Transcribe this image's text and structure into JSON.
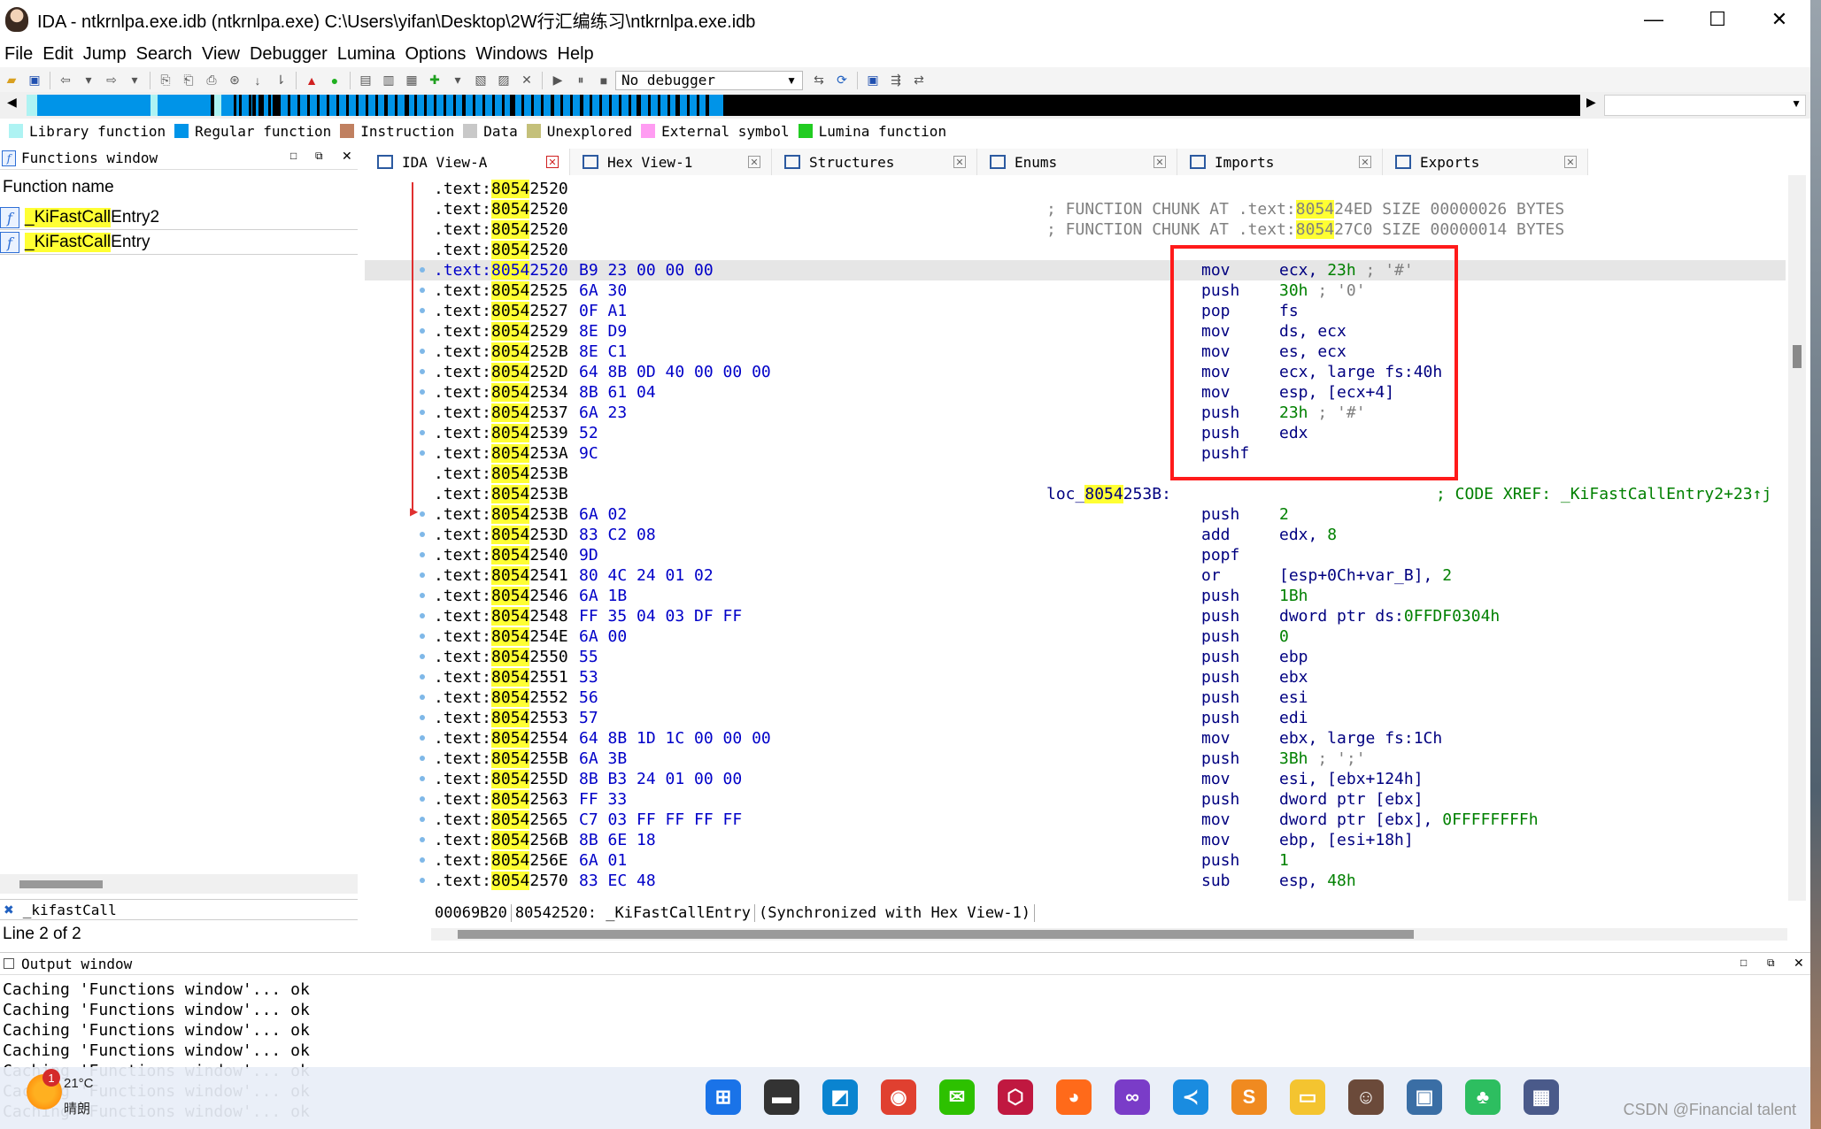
{
  "window": {
    "title": "IDA - ntkrnlpa.exe.idb (ntkrnlpa.exe) C:\\Users\\yifan\\Desktop\\2W行汇编练习\\ntkrnlpa.exe.idb",
    "minimize": "—",
    "maximize": "☐",
    "close": "✕"
  },
  "menu": [
    "File",
    "Edit",
    "Jump",
    "Search",
    "View",
    "Debugger",
    "Lumina",
    "Options",
    "Windows",
    "Help"
  ],
  "toolbar": {
    "debugger": "No debugger"
  },
  "legend": [
    {
      "label": "Library function",
      "color": "#aef3f3"
    },
    {
      "label": "Regular function",
      "color": "#0094e8"
    },
    {
      "label": "Instruction",
      "color": "#c08060"
    },
    {
      "label": "Data",
      "color": "#c8c8c8"
    },
    {
      "label": "Unexplored",
      "color": "#c4c07a"
    },
    {
      "label": "External symbol",
      "color": "#ff9cf2"
    },
    {
      "label": "Lumina function",
      "color": "#22cc22"
    }
  ],
  "functions_window": {
    "title": "Functions window",
    "column": "Function name",
    "items": [
      {
        "highlight": "_KiFastCall",
        "rest": "Entry2"
      },
      {
        "highlight": "_KiFastCall",
        "rest": "Entry"
      }
    ],
    "filter": "_kifastCall",
    "status": "Line 2 of 2"
  },
  "tabs": [
    {
      "label": "IDA View-A",
      "icon": "ida-view-icon"
    },
    {
      "label": "Hex View-1",
      "icon": "hex-view-icon"
    },
    {
      "label": "Structures",
      "icon": "structures-icon"
    },
    {
      "label": "Enums",
      "icon": "enums-icon"
    },
    {
      "label": "Imports",
      "icon": "imports-icon"
    },
    {
      "label": "Exports",
      "icon": "exports-icon"
    }
  ],
  "disasm": {
    "seg_prefix": ".text:",
    "addr_hl": "8054",
    "lines": [
      {
        "addr_rest": "2520"
      },
      {
        "addr_rest": "2520",
        "chunk": "; FUNCTION CHUNK AT .text:",
        "chunk_hl": "8054",
        "chunk_rest": "24ED SIZE 00000026 BYTES"
      },
      {
        "addr_rest": "2520",
        "chunk": "; FUNCTION CHUNK AT .text:",
        "chunk_hl": "8054",
        "chunk_rest": "27C0 SIZE 00000014 BYTES"
      },
      {
        "addr_rest": "2520"
      },
      {
        "addr_rest": "2520",
        "bytes": "B9 23 00 00 00",
        "mnem": "mov",
        "ops": "ecx, ",
        "num": "23h",
        "cmt": " ; '#'",
        "dot": true,
        "current": true
      },
      {
        "addr_rest": "2525",
        "bytes": "6A 30",
        "mnem": "push",
        "ops": "",
        "num": "30h",
        "cmt": " ; '0'",
        "dot": true
      },
      {
        "addr_rest": "2527",
        "bytes": "0F A1",
        "mnem": "pop",
        "ops": "fs",
        "dot": true
      },
      {
        "addr_rest": "2529",
        "bytes": "8E D9",
        "mnem": "mov",
        "ops": "ds, ecx",
        "dot": true
      },
      {
        "addr_rest": "252B",
        "bytes": "8E C1",
        "mnem": "mov",
        "ops": "es, ecx",
        "dot": true
      },
      {
        "addr_rest": "252D",
        "bytes": "64 8B 0D 40 00 00 00",
        "mnem": "mov",
        "ops": "ecx, large fs:40h",
        "dot": true
      },
      {
        "addr_rest": "2534",
        "bytes": "8B 61 04",
        "mnem": "mov",
        "ops": "esp, [ecx+4]",
        "dot": true
      },
      {
        "addr_rest": "2537",
        "bytes": "6A 23",
        "mnem": "push",
        "ops": "",
        "num": "23h",
        "cmt": " ; '#'",
        "dot": true
      },
      {
        "addr_rest": "2539",
        "bytes": "52",
        "mnem": "push",
        "ops": "edx",
        "dot": true
      },
      {
        "addr_rest": "253A",
        "bytes": "9C",
        "mnem": "pushf",
        "ops": "",
        "dot": true
      },
      {
        "addr_rest": "253B"
      },
      {
        "addr_rest": "253B",
        "label": "loc_",
        "label_hl": "8054",
        "label_rest": "253B:",
        "xref": "; CODE XREF: _KiFastCallEntry2+23↑j"
      },
      {
        "addr_rest": "253B",
        "bytes": "6A 02",
        "mnem": "push",
        "ops": "",
        "num": "2",
        "dot": true
      },
      {
        "addr_rest": "253D",
        "bytes": "83 C2 08",
        "mnem": "add",
        "ops": "edx, ",
        "num": "8",
        "dot": true
      },
      {
        "addr_rest": "2540",
        "bytes": "9D",
        "mnem": "popf",
        "ops": "",
        "dot": true
      },
      {
        "addr_rest": "2541",
        "bytes": "80 4C 24 01 02",
        "mnem": "or",
        "ops": "[esp+0Ch+var_B], ",
        "num": "2",
        "dot": true
      },
      {
        "addr_rest": "2546",
        "bytes": "6A 1B",
        "mnem": "push",
        "ops": "",
        "num": "1Bh",
        "dot": true
      },
      {
        "addr_rest": "2548",
        "bytes": "FF 35 04 03 DF FF",
        "mnem": "push",
        "ops": "dword ptr ds:",
        "num": "0FFDF0304h",
        "dot": true
      },
      {
        "addr_rest": "254E",
        "bytes": "6A 00",
        "mnem": "push",
        "ops": "",
        "num": "0",
        "dot": true
      },
      {
        "addr_rest": "2550",
        "bytes": "55",
        "mnem": "push",
        "ops": "ebp",
        "dot": true
      },
      {
        "addr_rest": "2551",
        "bytes": "53",
        "mnem": "push",
        "ops": "ebx",
        "dot": true
      },
      {
        "addr_rest": "2552",
        "bytes": "56",
        "mnem": "push",
        "ops": "esi",
        "dot": true
      },
      {
        "addr_rest": "2553",
        "bytes": "57",
        "mnem": "push",
        "ops": "edi",
        "dot": true
      },
      {
        "addr_rest": "2554",
        "bytes": "64 8B 1D 1C 00 00 00",
        "mnem": "mov",
        "ops": "ebx, large fs:1Ch",
        "dot": true
      },
      {
        "addr_rest": "255B",
        "bytes": "6A 3B",
        "mnem": "push",
        "ops": "",
        "num": "3Bh",
        "cmt": " ; ';'",
        "dot": true
      },
      {
        "addr_rest": "255D",
        "bytes": "8B B3 24 01 00 00",
        "mnem": "mov",
        "ops": "esi, [ebx+124h]",
        "dot": true
      },
      {
        "addr_rest": "2563",
        "bytes": "FF 33",
        "mnem": "push",
        "ops": "dword ptr [ebx]",
        "dot": true
      },
      {
        "addr_rest": "2565",
        "bytes": "C7 03 FF FF FF FF",
        "mnem": "mov",
        "ops": "dword ptr [ebx], ",
        "num": "0FFFFFFFFh",
        "dot": true
      },
      {
        "addr_rest": "256B",
        "bytes": "8B 6E 18",
        "mnem": "mov",
        "ops": "ebp, [esi+18h]",
        "dot": true
      },
      {
        "addr_rest": "256E",
        "bytes": "6A 01",
        "mnem": "push",
        "ops": "",
        "num": "1",
        "dot": true
      },
      {
        "addr_rest": "2570",
        "bytes": "83 EC 48",
        "mnem": "sub",
        "ops": "esp, ",
        "num": "48h",
        "dot": true
      }
    ],
    "status": [
      "00069B20",
      "80542520: _KiFastCallEntry",
      "(Synchronized with Hex View-1)"
    ]
  },
  "output": {
    "title": "Output window",
    "lines": [
      "Caching 'Functions window'... ok",
      "Caching 'Functions window'... ok",
      "Caching 'Functions window'... ok",
      "Caching 'Functions window'... ok",
      "Caching 'Functions window'... ok",
      "Caching 'Functions window'... ok",
      "Caching 'Functions window'... ok"
    ]
  },
  "taskbar": {
    "weather_temp": "21°C",
    "weather_text": "晴朗",
    "badge": "1",
    "watermark": "CSDN @Financial talent",
    "apps": [
      {
        "name": "windows-start-icon",
        "color": "#1a73e8"
      },
      {
        "name": "terminal-icon",
        "color": "#333333"
      },
      {
        "name": "snip-tool-icon",
        "color": "#0a84d0"
      },
      {
        "name": "chrome-icon",
        "color": "#e04030"
      },
      {
        "name": "wechat-icon",
        "color": "#2dc100"
      },
      {
        "name": "hexagon-app-icon",
        "color": "#c01840"
      },
      {
        "name": "firefox-icon",
        "color": "#ff6a1a"
      },
      {
        "name": "visual-studio-icon",
        "color": "#7a3cc8"
      },
      {
        "name": "vscode-icon",
        "color": "#1a8ce0"
      },
      {
        "name": "sublime-icon",
        "color": "#f08a20"
      },
      {
        "name": "file-explorer-icon",
        "color": "#f4c430"
      },
      {
        "name": "ida-icon",
        "color": "#6b4a3a"
      },
      {
        "name": "remote-desktop-icon",
        "color": "#3a6ea5"
      },
      {
        "name": "evernote-icon",
        "color": "#2dbe60"
      },
      {
        "name": "calculator-icon",
        "color": "#4a5a8a"
      }
    ]
  }
}
